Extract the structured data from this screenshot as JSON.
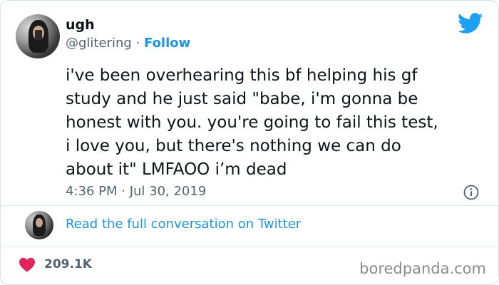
{
  "author": {
    "display_name": "ugh",
    "handle": "@glitering",
    "separator": "·",
    "follow_label": "Follow"
  },
  "tweet": {
    "text": "i've been overhearing this bf helping his gf\nstudy and he just said \"babe, i'm gonna be\nhonest with you. you're going to fail this test,\ni love you, but there's nothing we can do\nabout it\" LMFAOO i’m dead",
    "timestamp": "4:36 PM · Jul 30, 2019"
  },
  "conversation": {
    "link_text": "Read the full conversation on Twitter"
  },
  "stats": {
    "likes": "209.1K"
  },
  "watermark": "boredpanda.com",
  "colors": {
    "accent": "#1b95e0",
    "heart": "#e0245e",
    "bird": "#1da1f2",
    "muted_text": "#536471"
  },
  "icons": {
    "bird": "twitter-bird-icon",
    "info": "info-icon",
    "heart": "heart-icon"
  }
}
